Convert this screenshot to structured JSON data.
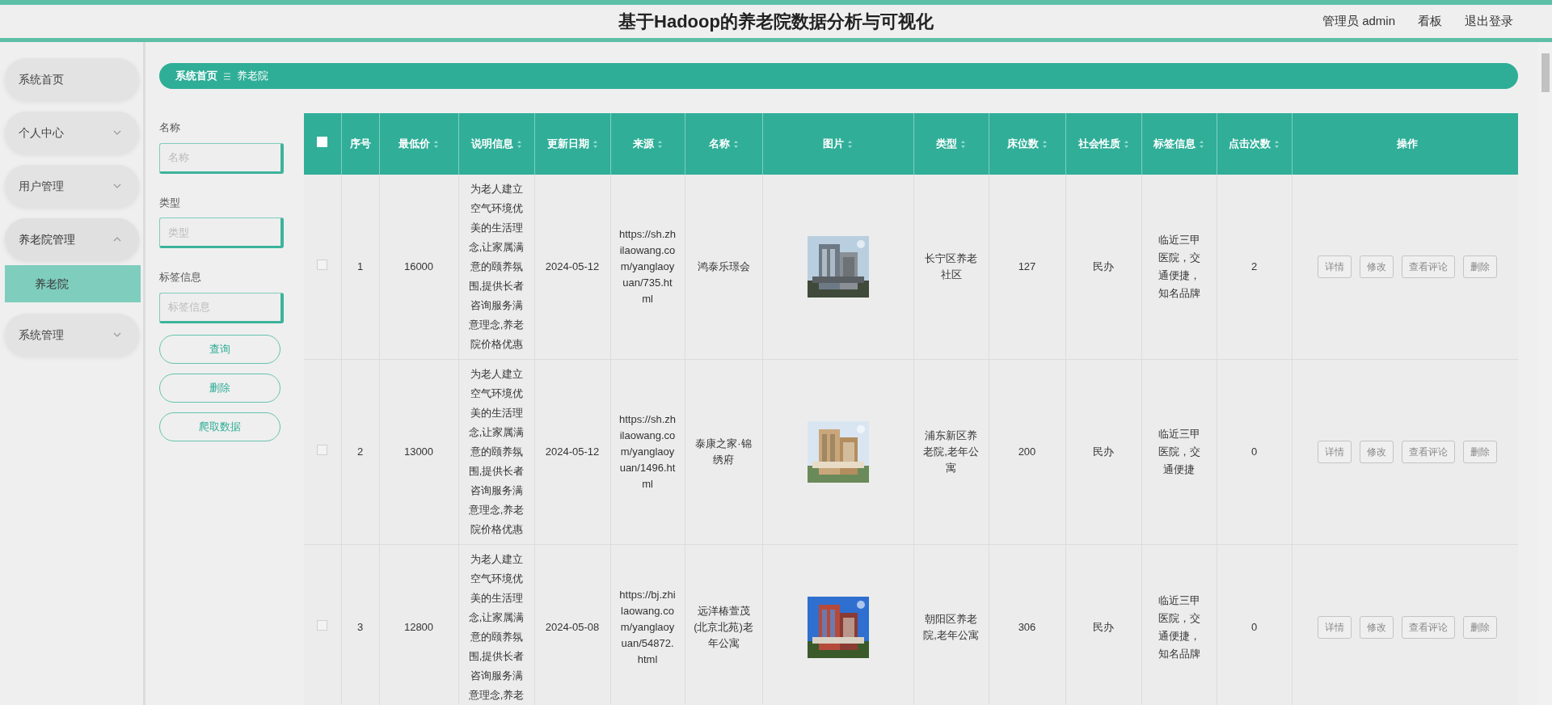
{
  "header": {
    "title": "基于Hadoop的养老院数据分析与可视化",
    "links": [
      "管理员 admin",
      "看板",
      "退出登录"
    ]
  },
  "sidebar": {
    "items": [
      {
        "label": "系统首页",
        "expandable": false
      },
      {
        "label": "个人中心",
        "expandable": true,
        "expanded": false
      },
      {
        "label": "用户管理",
        "expandable": true,
        "expanded": false
      },
      {
        "label": "养老院管理",
        "expandable": true,
        "expanded": true,
        "children": [
          {
            "label": "养老院",
            "selected": true
          }
        ]
      },
      {
        "label": "系统管理",
        "expandable": true,
        "expanded": false
      }
    ]
  },
  "breadcrumb": [
    "系统首页",
    "养老院"
  ],
  "filters": {
    "fields": [
      {
        "label": "名称",
        "placeholder": "名称"
      },
      {
        "label": "类型",
        "placeholder": "类型"
      },
      {
        "label": "标签信息",
        "placeholder": "标签信息"
      }
    ],
    "buttons": [
      "查询",
      "删除",
      "爬取数据"
    ]
  },
  "table": {
    "select_all": {
      "checked": false
    },
    "columns": [
      {
        "label": "序号",
        "sortable": false
      },
      {
        "label": "最低价",
        "sortable": true
      },
      {
        "label": "说明信息",
        "sortable": true
      },
      {
        "label": "更新日期",
        "sortable": true
      },
      {
        "label": "来源",
        "sortable": true
      },
      {
        "label": "名称",
        "sortable": true
      },
      {
        "label": "图片",
        "sortable": true
      },
      {
        "label": "类型",
        "sortable": true
      },
      {
        "label": "床位数",
        "sortable": true
      },
      {
        "label": "社会性质",
        "sortable": true
      },
      {
        "label": "标签信息",
        "sortable": true
      },
      {
        "label": "点击次数",
        "sortable": true
      },
      {
        "label": "操作",
        "sortable": false
      }
    ],
    "rows": [
      {
        "checked": false,
        "index": "1",
        "price": "16000",
        "description": "为老人建立空气环境优美的生活理念,让家属满意的颐养氛围,提供长者咨询服务满意理念,养老院价格优惠",
        "date": "2024-05-12",
        "source": "https://sh.zhilaowang.com/yanglaoyuan/735.html",
        "name": "鸿泰乐璟会",
        "image": {
          "kind": "picture"
        },
        "type": "长宁区养老社区",
        "beds": "127",
        "nature": "民办",
        "tags": "临近三甲医院，交通便捷，知名品牌",
        "clicks": "2",
        "actions": [
          "详情",
          "修改",
          "查看评论",
          "删除"
        ]
      },
      {
        "checked": false,
        "index": "2",
        "price": "13000",
        "description": "为老人建立空气环境优美的生活理念,让家属满意的颐养氛围,提供长者咨询服务满意理念,养老院价格优惠",
        "date": "2024-05-12",
        "source": "https://sh.zhilaowang.com/yanglaoyuan/1496.html",
        "name": "泰康之家·锦绣府",
        "image": {
          "kind": "picture"
        },
        "type": "浦东新区养老院,老年公寓",
        "beds": "200",
        "nature": "民办",
        "tags": "临近三甲医院，交通便捷",
        "clicks": "0",
        "actions": [
          "详情",
          "修改",
          "查看评论",
          "删除"
        ]
      },
      {
        "checked": false,
        "index": "3",
        "price": "12800",
        "description": "为老人建立空气环境优美的生活理念,让家属满意的颐养氛围,提供长者咨询服务满意理念,养老",
        "date": "2024-05-08",
        "source": "https://bj.zhilaowang.com/yanglaoyuan/54872.html",
        "name": "远洋椿萱茂(北京北苑)老年公寓",
        "image": {
          "kind": "picture"
        },
        "type": "朝阳区养老院,老年公寓",
        "beds": "306",
        "nature": "民办",
        "tags": "临近三甲医院，交通便捷，知名品牌",
        "clicks": "0",
        "actions": [
          "详情",
          "修改",
          "查看评论",
          "删除"
        ]
      }
    ]
  }
}
